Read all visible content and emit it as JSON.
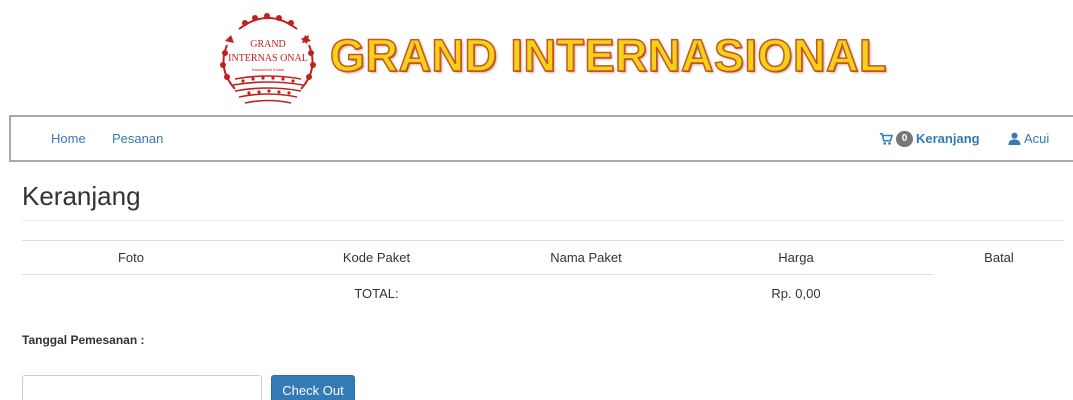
{
  "brand": {
    "title": "GRAND INTERNASIONAL",
    "emblem_line1": "GRAND",
    "emblem_line2": "INTERNAS ONAL",
    "emblem_tagline": "Kasambuni Kuliah",
    "emblem_color": "#c0201e",
    "title_color": "#f5d21a",
    "title_outline_color": "#c8561e"
  },
  "navbar": {
    "left_links": [
      "Home",
      "Pesanan"
    ],
    "cart": {
      "icon": "cart-icon",
      "count": "0",
      "label": "Keranjang"
    },
    "user": {
      "icon": "user-icon",
      "label": "Acui"
    },
    "link_color": "#337ab7"
  },
  "page": {
    "title": "Keranjang"
  },
  "cart_table": {
    "columns": [
      "Foto",
      "Kode Paket",
      "Nama Paket",
      "Harga",
      "Batal"
    ],
    "total_label": "TOTAL:",
    "total_value": "Rp. 0,00"
  },
  "order_form": {
    "date_label": "Tanggal Pemesanan :",
    "date_value": "",
    "checkout_label": "Check Out",
    "button_color": "#337ab7"
  }
}
